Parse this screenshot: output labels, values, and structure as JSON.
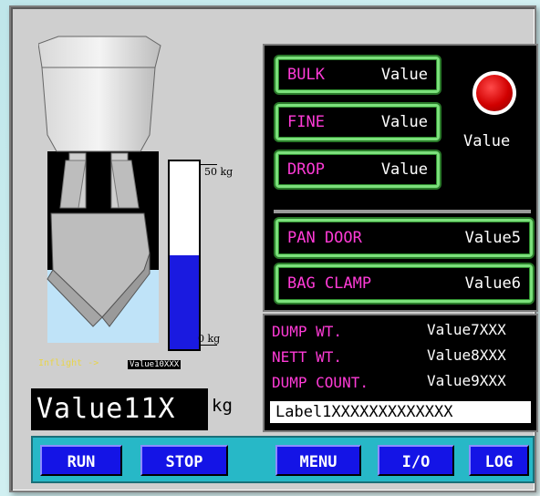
{
  "hopper": {
    "inflight_label": "Inflight ->",
    "inflight_value": "Value10XXX",
    "scale_max": "50 kg",
    "scale_min": "0 kg",
    "fill_level_fraction": 0.5,
    "weight_value": "Value11X",
    "weight_unit": "kg"
  },
  "status": {
    "bulk_label": "BULK",
    "bulk_value": "Value",
    "fine_label": "FINE",
    "fine_value": "Value",
    "drop_label": "DROP",
    "drop_value": "Value",
    "lamp_value": "Value",
    "lamp_color": "#d10000",
    "pan_door_label": "PAN DOOR",
    "pan_door_value": "Value5",
    "bag_clamp_label": "BAG CLAMP",
    "bag_clamp_value": "Value6"
  },
  "totals": {
    "dump_wt_label": "DUMP WT.",
    "dump_wt_value": "Value7XXX",
    "nett_wt_label": "NETT WT.",
    "nett_wt_value": "Value8XXX",
    "dump_count_label": "DUMP COUNT.",
    "dump_count_value": "Value9XXX",
    "label1": "Label1XXXXXXXXXXXXX"
  },
  "buttons": {
    "run": "RUN",
    "stop": "STOP",
    "menu": "MENU",
    "io": "I/O",
    "log": "LOG"
  },
  "colors": {
    "label_magenta": "#ff3bd7",
    "button_blue": "#1414e6",
    "frame_green": "#7be07b",
    "bottom_bar": "#27b8c7",
    "inflight_yellow": "#e8d44a"
  }
}
